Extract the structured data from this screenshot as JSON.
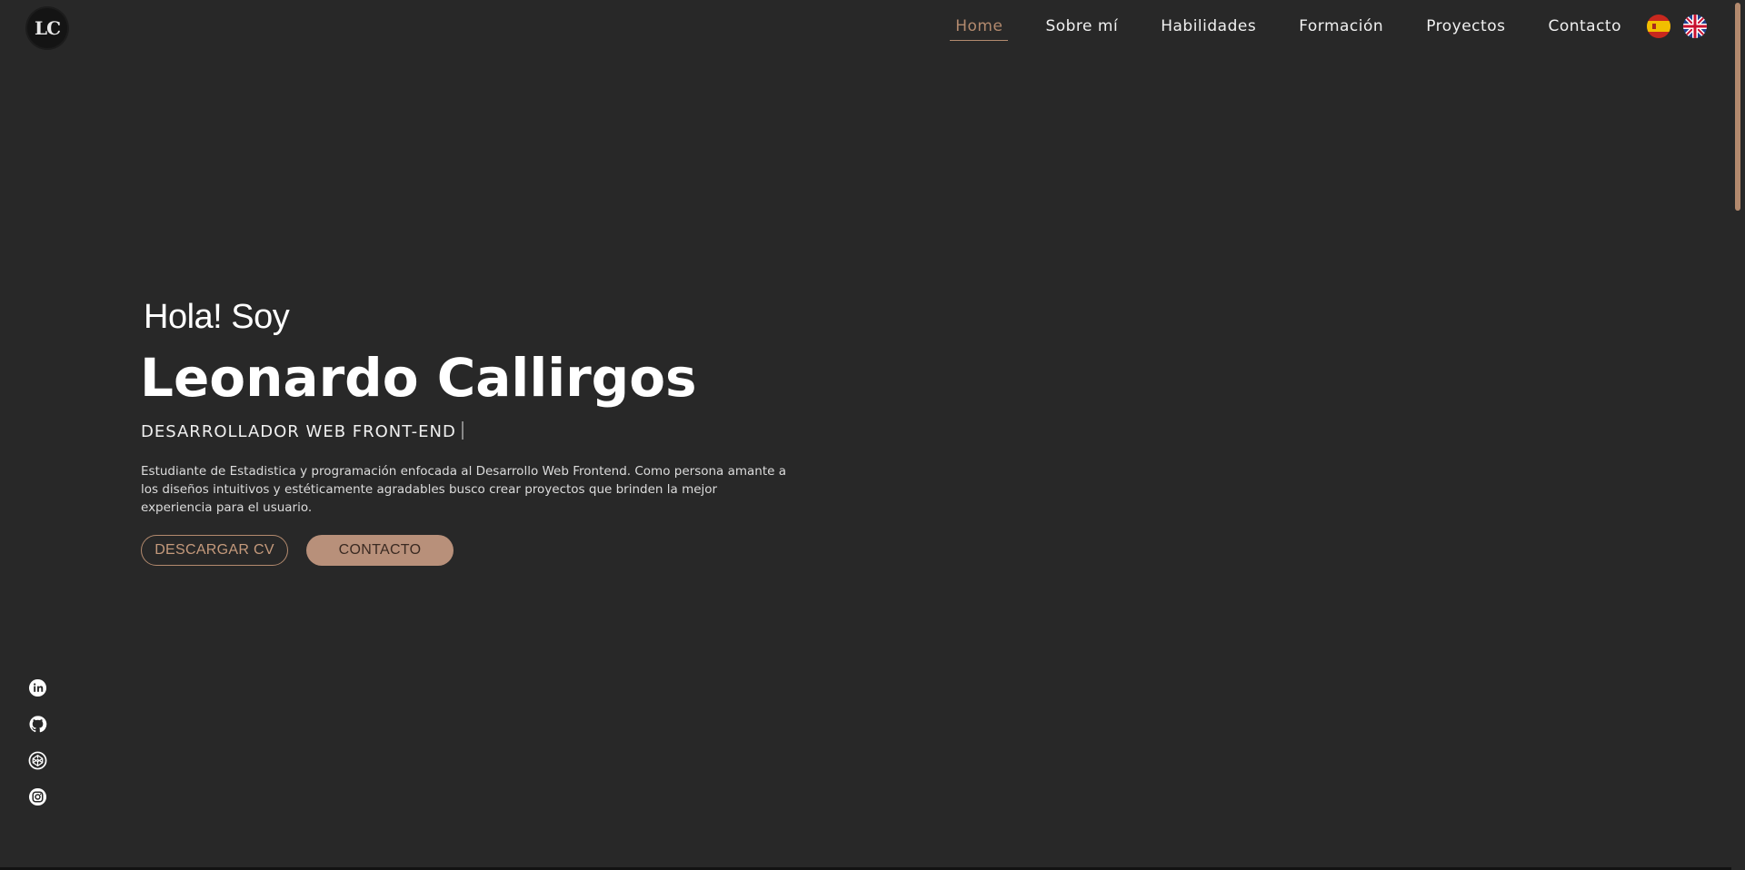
{
  "header": {
    "logo_text": "LC",
    "nav": [
      {
        "label": "Home",
        "active": true
      },
      {
        "label": "Sobre mí",
        "active": false
      },
      {
        "label": "Habilidades",
        "active": false
      },
      {
        "label": "Formación",
        "active": false
      },
      {
        "label": "Proyectos",
        "active": false
      },
      {
        "label": "Contacto",
        "active": false
      }
    ],
    "languages": [
      {
        "icon": "spain-flag-icon"
      },
      {
        "icon": "uk-flag-icon"
      }
    ]
  },
  "hero": {
    "greeting": "Hola! Soy",
    "name": "Leonardo Callirgos",
    "role": "DESARROLLADOR WEB FRONT-END",
    "description": "Estudiante de Estadistica y programación enfocada al Desarrollo Web Frontend. Como persona amante a los diseños intuitivos y estéticamente agradables busco crear proyectos que brinden la mejor experiencia para el usuario.",
    "btn_cv": "DESCARGAR CV",
    "btn_contact": "CONTACTO"
  },
  "social": [
    {
      "icon": "linkedin-icon"
    },
    {
      "icon": "github-icon"
    },
    {
      "icon": "codepen-icon"
    },
    {
      "icon": "instagram-icon"
    }
  ],
  "colors": {
    "background": "#282828",
    "accent": "#b38a6e",
    "button_fill": "#b8907a",
    "text": "#ffffff"
  }
}
